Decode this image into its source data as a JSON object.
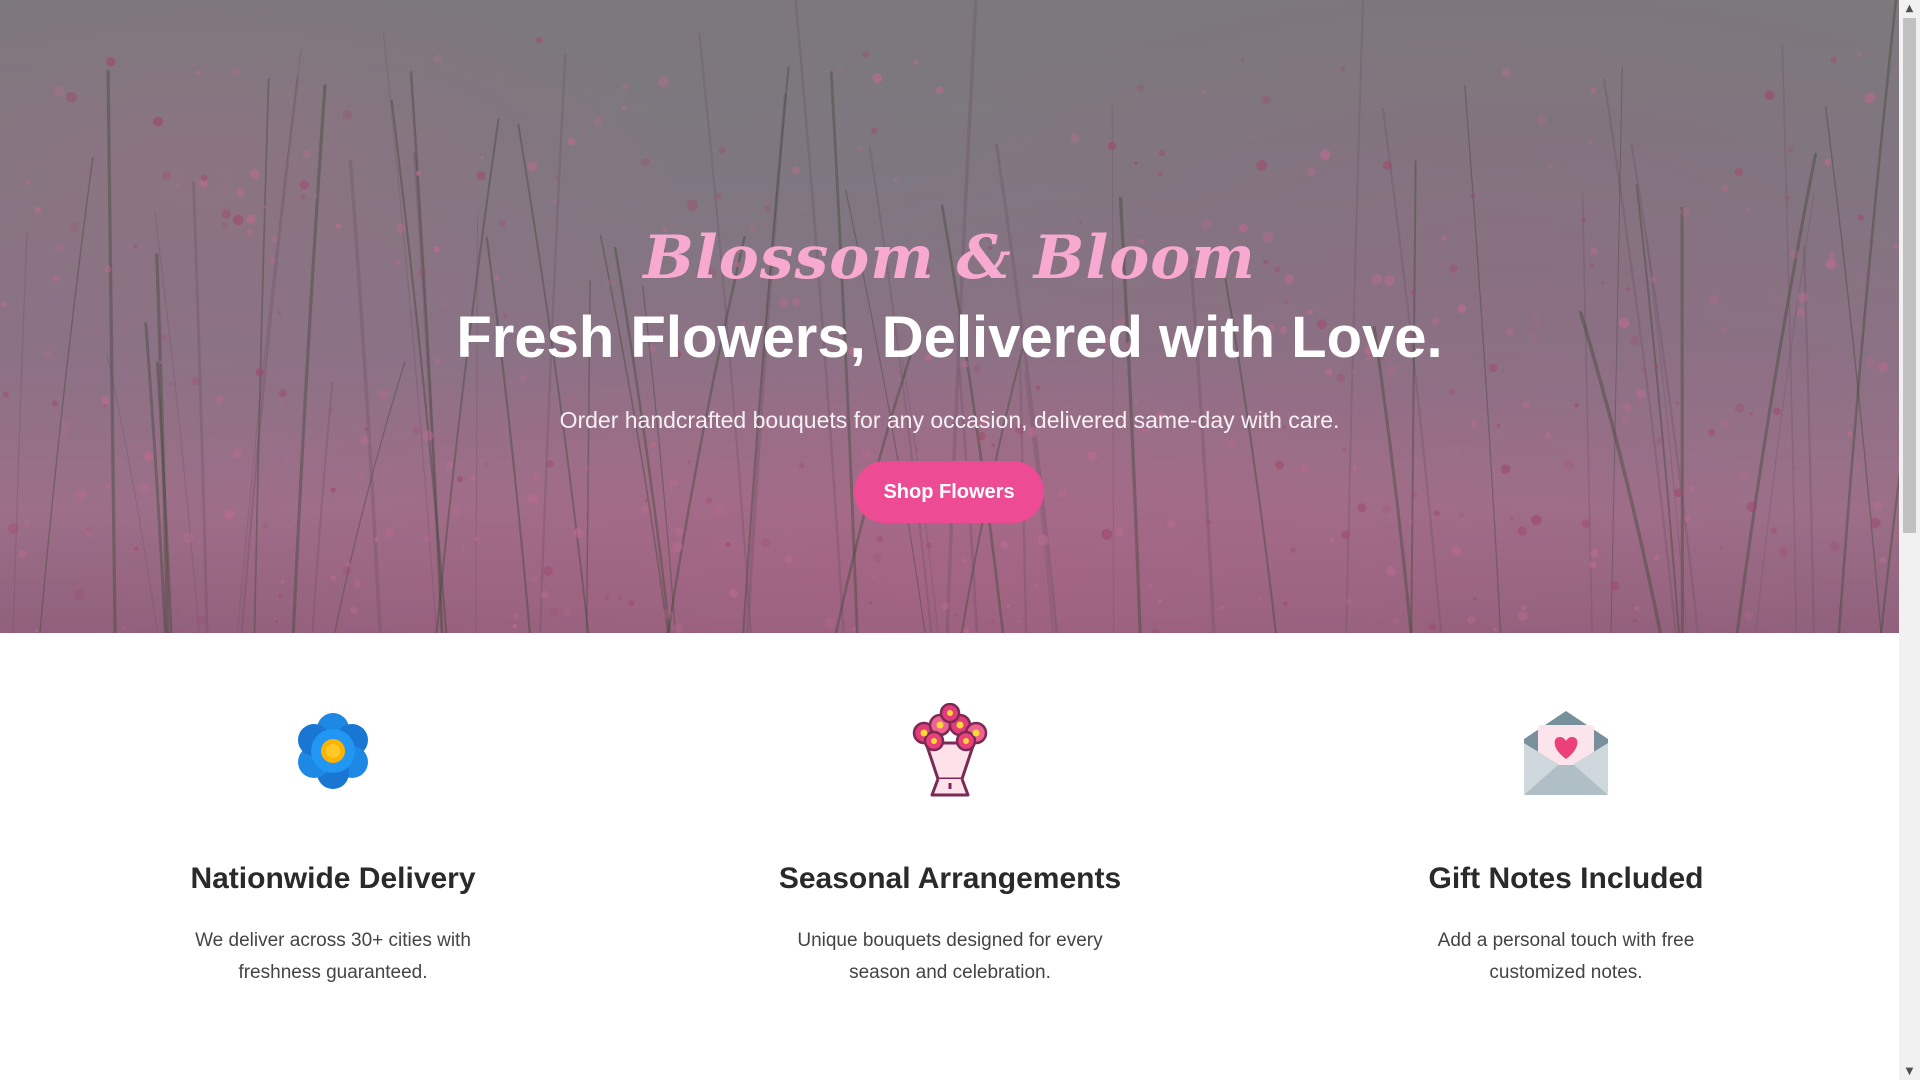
{
  "hero": {
    "brand": "Blossom & Bloom",
    "headline": "Fresh Flowers, Delivered with Love.",
    "subline": "Order handcrafted bouquets for any occasion, delivered same-day with care.",
    "cta_label": "Shop Flowers",
    "cta_color": "#ee4b95",
    "brand_color": "#f7a9cf"
  },
  "features": [
    {
      "icon": "flower-icon",
      "title": "Nationwide Delivery",
      "text": "We deliver across 30+ cities with freshness guaranteed."
    },
    {
      "icon": "bouquet-icon",
      "title": "Seasonal Arrangements",
      "text": "Unique bouquets designed for every season and celebration."
    },
    {
      "icon": "love-letter-icon",
      "title": "Gift Notes Included",
      "text": "Add a personal touch with free customized notes."
    }
  ],
  "scrollbar": {
    "up_glyph": "▲",
    "down_glyph": "▼"
  }
}
